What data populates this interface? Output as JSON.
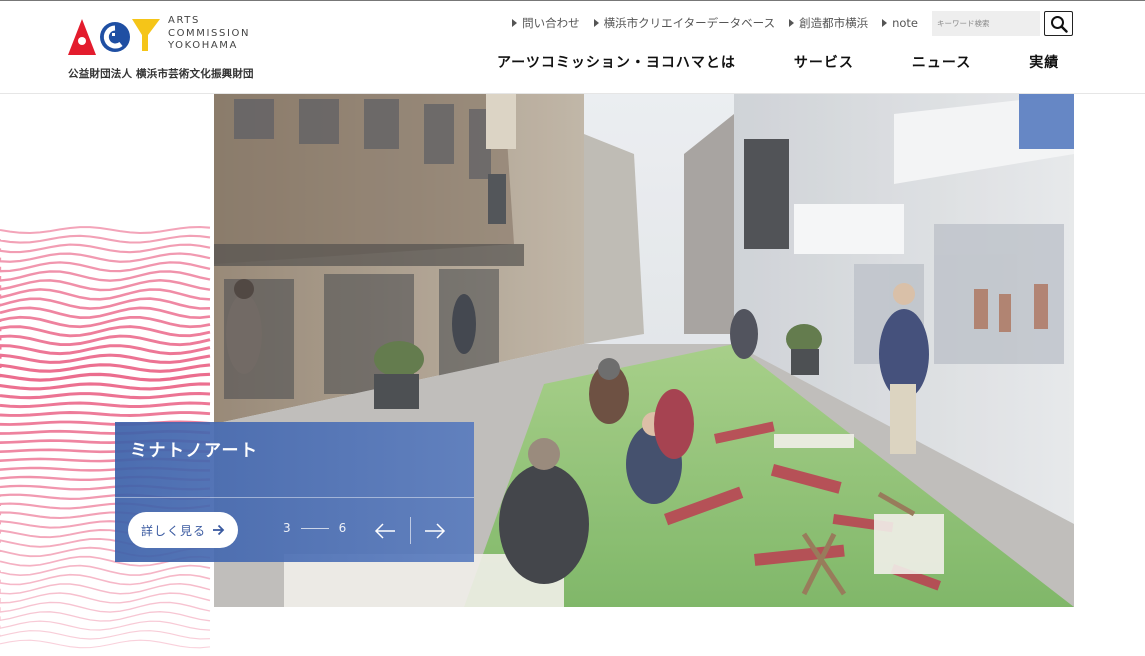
{
  "logo": {
    "line1": "ARTS",
    "line2": "COMMISSION",
    "line3": "YOKOHAMA",
    "org": "公益財団法人 横浜市芸術文化振興財団",
    "colors": {
      "red": "#e31c2d",
      "blue": "#1f4fa3",
      "yellow": "#f5c518"
    }
  },
  "utility_nav": [
    {
      "label": "問い合わせ"
    },
    {
      "label": "横浜市クリエイターデータベース"
    },
    {
      "label": "創造都市横浜"
    },
    {
      "label": "note"
    }
  ],
  "search": {
    "placeholder": "キーワード検索",
    "icon": "search-icon"
  },
  "global_nav": [
    {
      "label": "アーツコミッション・ヨコハマとは"
    },
    {
      "label": "サービス"
    },
    {
      "label": "ニュース"
    },
    {
      "label": "実績"
    }
  ],
  "hero": {
    "title": "ミナトノアート",
    "more_label": "詳しく見る",
    "current_slide": "3",
    "total_slides": "6",
    "panel_color": "#3e62aa",
    "accent_pink": "#e8537a"
  }
}
